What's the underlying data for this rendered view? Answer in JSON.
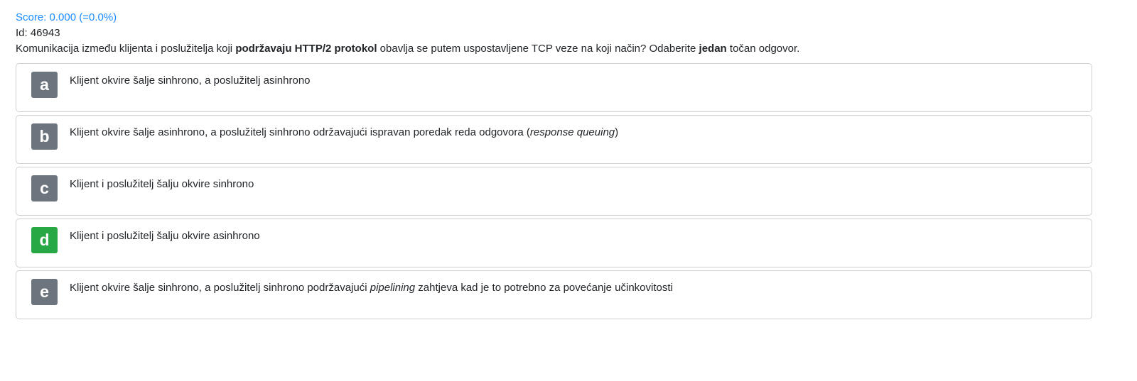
{
  "score": "Score: 0.000 (=0.0%)",
  "id": "Id: 46943",
  "question": {
    "p1": "Komunikacija između klijenta i poslužitelja koji ",
    "b1": "podržavaju HTTP/2 protokol",
    "p2": " obavlja se putem uspostavljene TCP veze na koji način? Odaberite ",
    "b2": "jedan",
    "p3": " točan odgovor."
  },
  "options": [
    {
      "letter": "a",
      "text": "Klijent okvire šalje sinhrono, a poslužitelj asinhrono",
      "correct": false
    },
    {
      "letter": "b",
      "pre": "Klijent okvire šalje asinhrono, a poslužitelj sinhrono održavajući ispravan poredak reda odgovora (",
      "em": "response queuing",
      "post": ")",
      "correct": false
    },
    {
      "letter": "c",
      "text": "Klijent i poslužitelj šalju okvire sinhrono",
      "correct": false
    },
    {
      "letter": "d",
      "text": "Klijent i poslužitelj šalju okvire asinhrono",
      "correct": true
    },
    {
      "letter": "e",
      "pre": "Klijent okvire šalje sinhrono, a poslužitelj sinhrono podržavajući ",
      "em": "pipelining",
      "post": " zahtjeva kad je to potrebno za povećanje učinkovitosti",
      "correct": false
    }
  ],
  "colors": {
    "correct": "#28a745",
    "neutral": "#6c757d",
    "score": "#1a8cff"
  }
}
